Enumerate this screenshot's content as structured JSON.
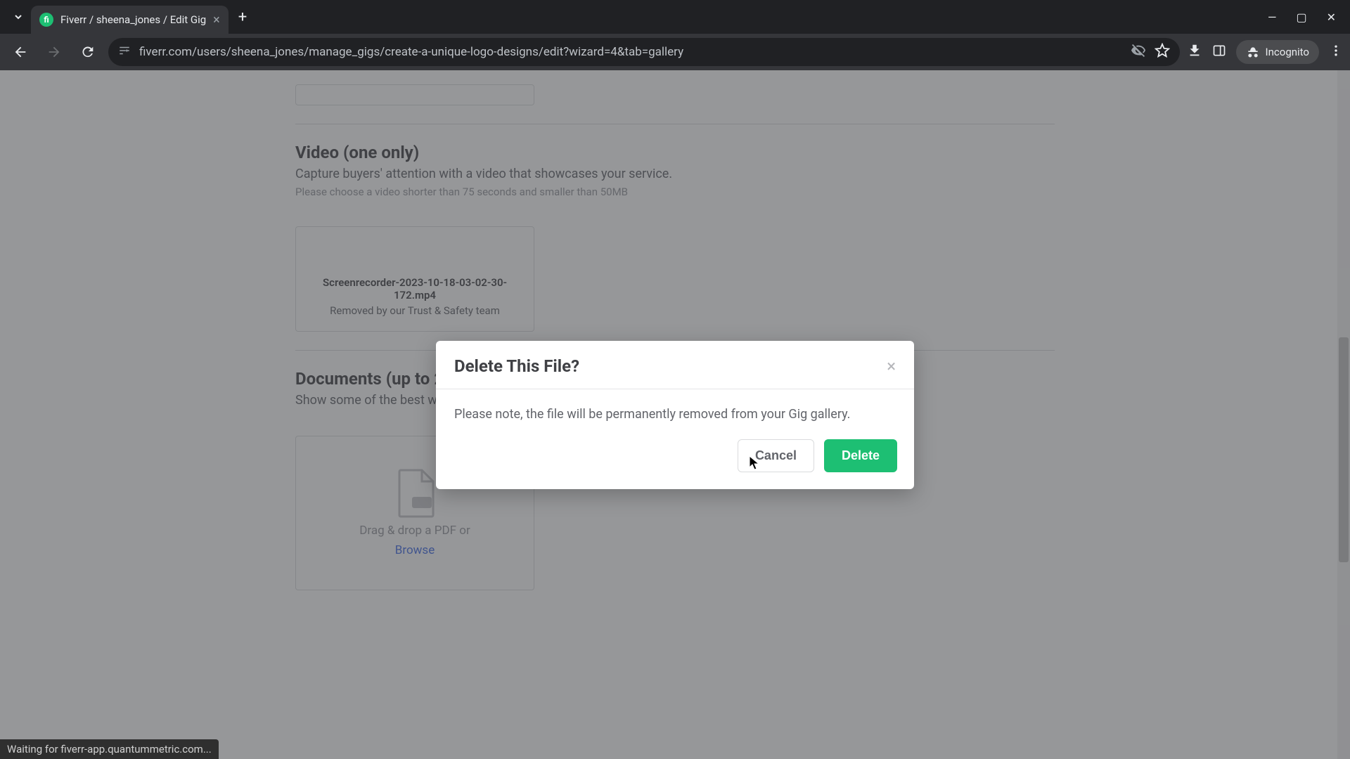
{
  "browser": {
    "tab_title": "Fiverr / sheena_jones / Edit Gig",
    "url_display": "fiverr.com/users/sheena_jones/manage_gigs/create-a-unique-logo-designs/edit?wizard=4&tab=gallery",
    "incognito_label": "Incognito",
    "status_text": "Waiting for fiverr-app.quantummetric.com..."
  },
  "sections": {
    "video": {
      "title": "Video (one only)",
      "subtitle": "Capture buyers' attention with a video that showcases your service.",
      "note": "Please choose a video shorter than 75 seconds and smaller than 50MB",
      "file": {
        "name": "Screenrecorder-2023-10-18-03-02-30-172.mp4",
        "status": "Removed by our Trust & Safety team"
      }
    },
    "documents": {
      "title": "Documents (up to 2)",
      "subtitle": "Show some of the best work you",
      "drop_text": "Drag & drop a PDF or",
      "browse_label": "Browse"
    }
  },
  "modal": {
    "title": "Delete This File?",
    "body": "Please note, the file will be permanently removed from your Gig gallery.",
    "cancel_label": "Cancel",
    "delete_label": "Delete"
  }
}
